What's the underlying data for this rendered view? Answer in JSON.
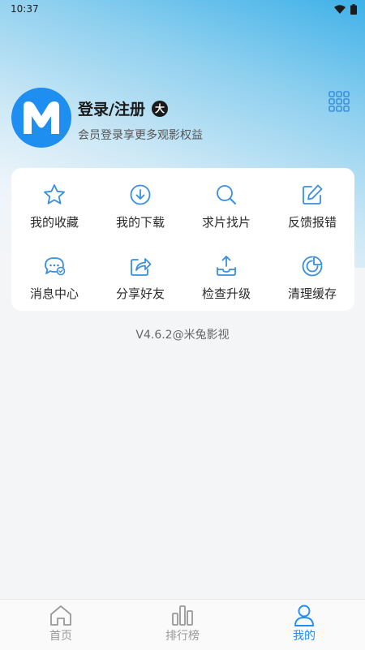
{
  "status_bar": {
    "time": "10:37"
  },
  "profile": {
    "avatar_letter": "M",
    "login_title": "登录/注册",
    "vip_badge_char": "大",
    "subtitle": "会员登录享更多观影权益"
  },
  "menu": {
    "items": [
      {
        "label": "我的收藏",
        "icon": "star-icon"
      },
      {
        "label": "我的下载",
        "icon": "download-icon"
      },
      {
        "label": "求片找片",
        "icon": "search-icon"
      },
      {
        "label": "反馈报错",
        "icon": "edit-icon"
      },
      {
        "label": "消息中心",
        "icon": "message-icon"
      },
      {
        "label": "分享好友",
        "icon": "share-icon"
      },
      {
        "label": "检查升级",
        "icon": "upload-icon"
      },
      {
        "label": "清理缓存",
        "icon": "clean-icon"
      }
    ]
  },
  "version_text": "V4.6.2@米兔影视",
  "bottom_nav": {
    "items": [
      {
        "label": "首页",
        "icon": "home-icon",
        "active": false
      },
      {
        "label": "排行榜",
        "icon": "chart-icon",
        "active": false
      },
      {
        "label": "我的",
        "icon": "user-icon",
        "active": true
      }
    ]
  },
  "colors": {
    "accent": "#1f8ef1",
    "icon_blue": "#3a8fdc",
    "inactive": "#999999"
  }
}
